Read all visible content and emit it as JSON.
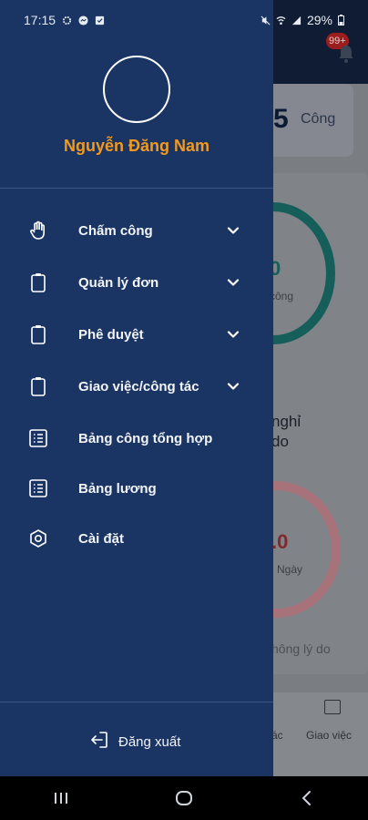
{
  "status_bar": {
    "time": "17:15",
    "battery": "29%"
  },
  "background": {
    "notification_badge": "99+",
    "summary_value": "5",
    "summary_unit": "Công",
    "ring1_value": "0",
    "ring1_unit": "công",
    "section_text_line1": "nghỉ",
    "section_text_line2": "do",
    "ring2_value": ".0",
    "ring2_unit": "Ngày",
    "section_text3": "hông lý do",
    "nav_partial_label": "ác",
    "nav_label": "Giao việc"
  },
  "drawer": {
    "user_name": "Nguyễn Đăng Nam",
    "menu": [
      {
        "label": "Chấm công",
        "icon": "hand-icon",
        "expandable": true
      },
      {
        "label": "Quản lý đơn",
        "icon": "clipboard-icon",
        "expandable": true
      },
      {
        "label": "Phê duyệt",
        "icon": "clipboard-icon",
        "expandable": true
      },
      {
        "label": "Giao việc/công tác",
        "icon": "clipboard-icon",
        "expandable": true
      },
      {
        "label": "Bảng công tổng hợp",
        "icon": "list-icon",
        "expandable": false
      },
      {
        "label": "Bảng lương",
        "icon": "list-icon",
        "expandable": false
      },
      {
        "label": "Cài đặt",
        "icon": "settings-icon",
        "expandable": false
      }
    ],
    "logout_label": "Đăng xuất"
  },
  "colors": {
    "drawer_bg": "#1a3564",
    "user_name": "#f39a1e",
    "text": "#f2f4f8"
  }
}
